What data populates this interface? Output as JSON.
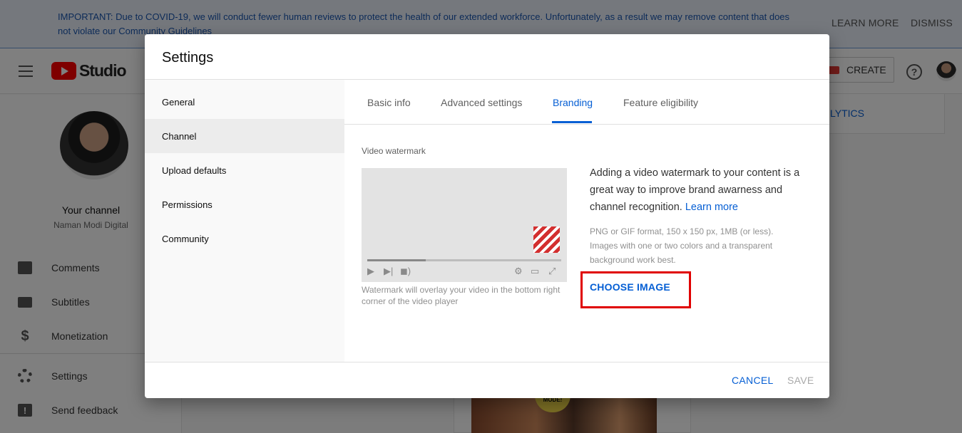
{
  "banner": {
    "text": "IMPORTANT: Due to COVID-19, we will conduct fewer human reviews to protect the health of our extended workforce. Unfortunately, as a result we may remove content that does not violate our Community Guidelines",
    "learn_more": "LEARN MORE",
    "dismiss": "DISMISS"
  },
  "header": {
    "logo_text": "Studio",
    "create_label": "CREATE",
    "help_icon_glyph": "?"
  },
  "sidebar": {
    "channel_title": "Your channel",
    "channel_name": "Naman Modi Digital",
    "items": [
      {
        "label": "Comments",
        "icon": "comments-icon"
      },
      {
        "label": "Subtitles",
        "icon": "subtitles-icon"
      },
      {
        "label": "Monetization",
        "icon": "dollar-icon"
      },
      {
        "label": "Settings",
        "icon": "gear-icon"
      },
      {
        "label": "Send feedback",
        "icon": "feedback-icon"
      }
    ],
    "monetization_glyph": "$",
    "feedback_glyph": "!"
  },
  "background": {
    "analytics_fragment": "LYTICS",
    "thumb_badge": "MODE!"
  },
  "dialog": {
    "title": "Settings",
    "nav": [
      {
        "label": "General",
        "active": false
      },
      {
        "label": "Channel",
        "active": true
      },
      {
        "label": "Upload defaults",
        "active": false
      },
      {
        "label": "Permissions",
        "active": false
      },
      {
        "label": "Community",
        "active": false
      }
    ],
    "tabs": [
      {
        "label": "Basic info",
        "active": false
      },
      {
        "label": "Advanced settings",
        "active": false
      },
      {
        "label": "Branding",
        "active": true
      },
      {
        "label": "Feature eligibility",
        "active": false
      }
    ],
    "branding": {
      "section_label": "Video watermark",
      "description": "Adding a video watermark to your content is a great way to improve brand awarness and channel recognition.",
      "learn_more": "Learn more",
      "requirements": "PNG or GIF format, 150 x 150 px, 1MB (or less). Images with one or two colors and a transparent background work best.",
      "preview_caption": "Watermark will overlay your video in the bottom right corner of the video player",
      "choose_image": "CHOOSE IMAGE",
      "preview_progress": 0.3
    },
    "footer": {
      "cancel": "CANCEL",
      "save": "SAVE"
    }
  },
  "colors": {
    "accent": "#065fd4",
    "highlight_box": "#e00000",
    "watermark_stripes": "#d32f2f"
  }
}
